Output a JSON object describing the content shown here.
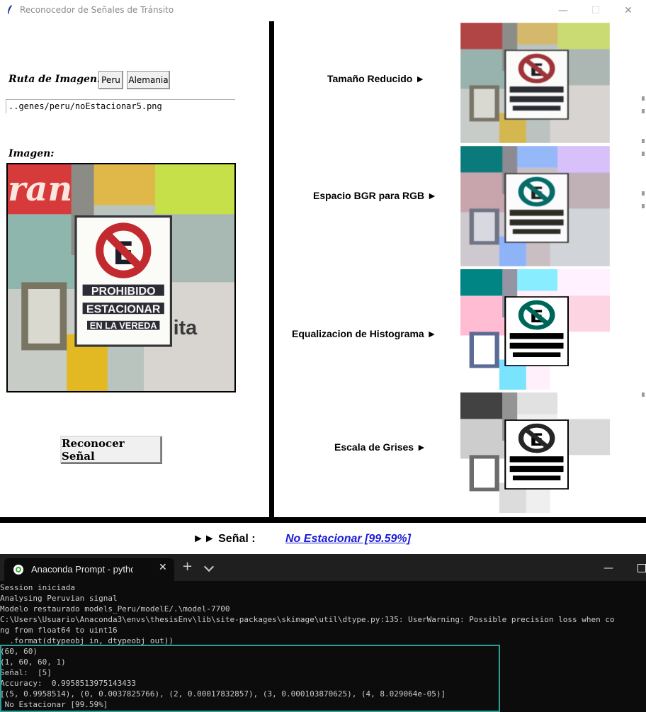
{
  "window": {
    "title": "Reconocedor de Señales de Tránsito",
    "icon": "feather-icon",
    "controls": {
      "minimize": "—",
      "maximize": "☐",
      "close": "✕"
    }
  },
  "left_panel": {
    "path_label": "Ruta de Imagen:",
    "buttons": [
      "Peru",
      "Alemania"
    ],
    "path_value": "..genes/peru/noEstacionar5.png",
    "image_label": "Imagen:",
    "sign_text": [
      "PROHIBIDO",
      "ESTACIONAR",
      "EN LA VEREDA"
    ],
    "recognize_button": "Reconocer Señal"
  },
  "steps": [
    {
      "label": "Tamaño Reducido ►",
      "filter": "reduced"
    },
    {
      "label": "Espacio BGR para RGB ►",
      "filter": "bgr"
    },
    {
      "label": "Equalizacion de Histograma ►",
      "filter": "equalized"
    },
    {
      "label": "Escala de Grises ►",
      "filter": "gray"
    }
  ],
  "result": {
    "prefix": "►► Señal :",
    "value": " No Estacionar [99.59%]",
    "value_color": "#1b1bd6"
  },
  "terminal": {
    "tab_title": "Anaconda Prompt - python  inte",
    "tab_close": "✕",
    "new_tab": "+",
    "minimize": "—",
    "lines": [
      "Session iniciada",
      "Analysing Peruvian signal",
      "Modelo restaurado models_Peru/modelE/.\\model-7700",
      "C:\\Users\\Usuario\\Anaconda3\\envs\\thesisEnv\\lib\\site-packages\\skimage\\util\\dtype.py:135: UserWarning: Possible precision loss when co",
      "ng from float64 to uint16",
      "  .format(dtypeobj_in, dtypeobj_out))",
      "(60, 60)",
      "(1, 60, 60, 1)",
      "Señal:  [5]",
      "Accuracy:  0.9958513975143433",
      "[(5, 0.9958514), (0, 0.0037825766), (2, 0.00017832857), (3, 0.000103870625), (4, 8.029064e-05)]",
      " No Estacionar [99.59%]"
    ],
    "selection_color": "#2aa198"
  }
}
